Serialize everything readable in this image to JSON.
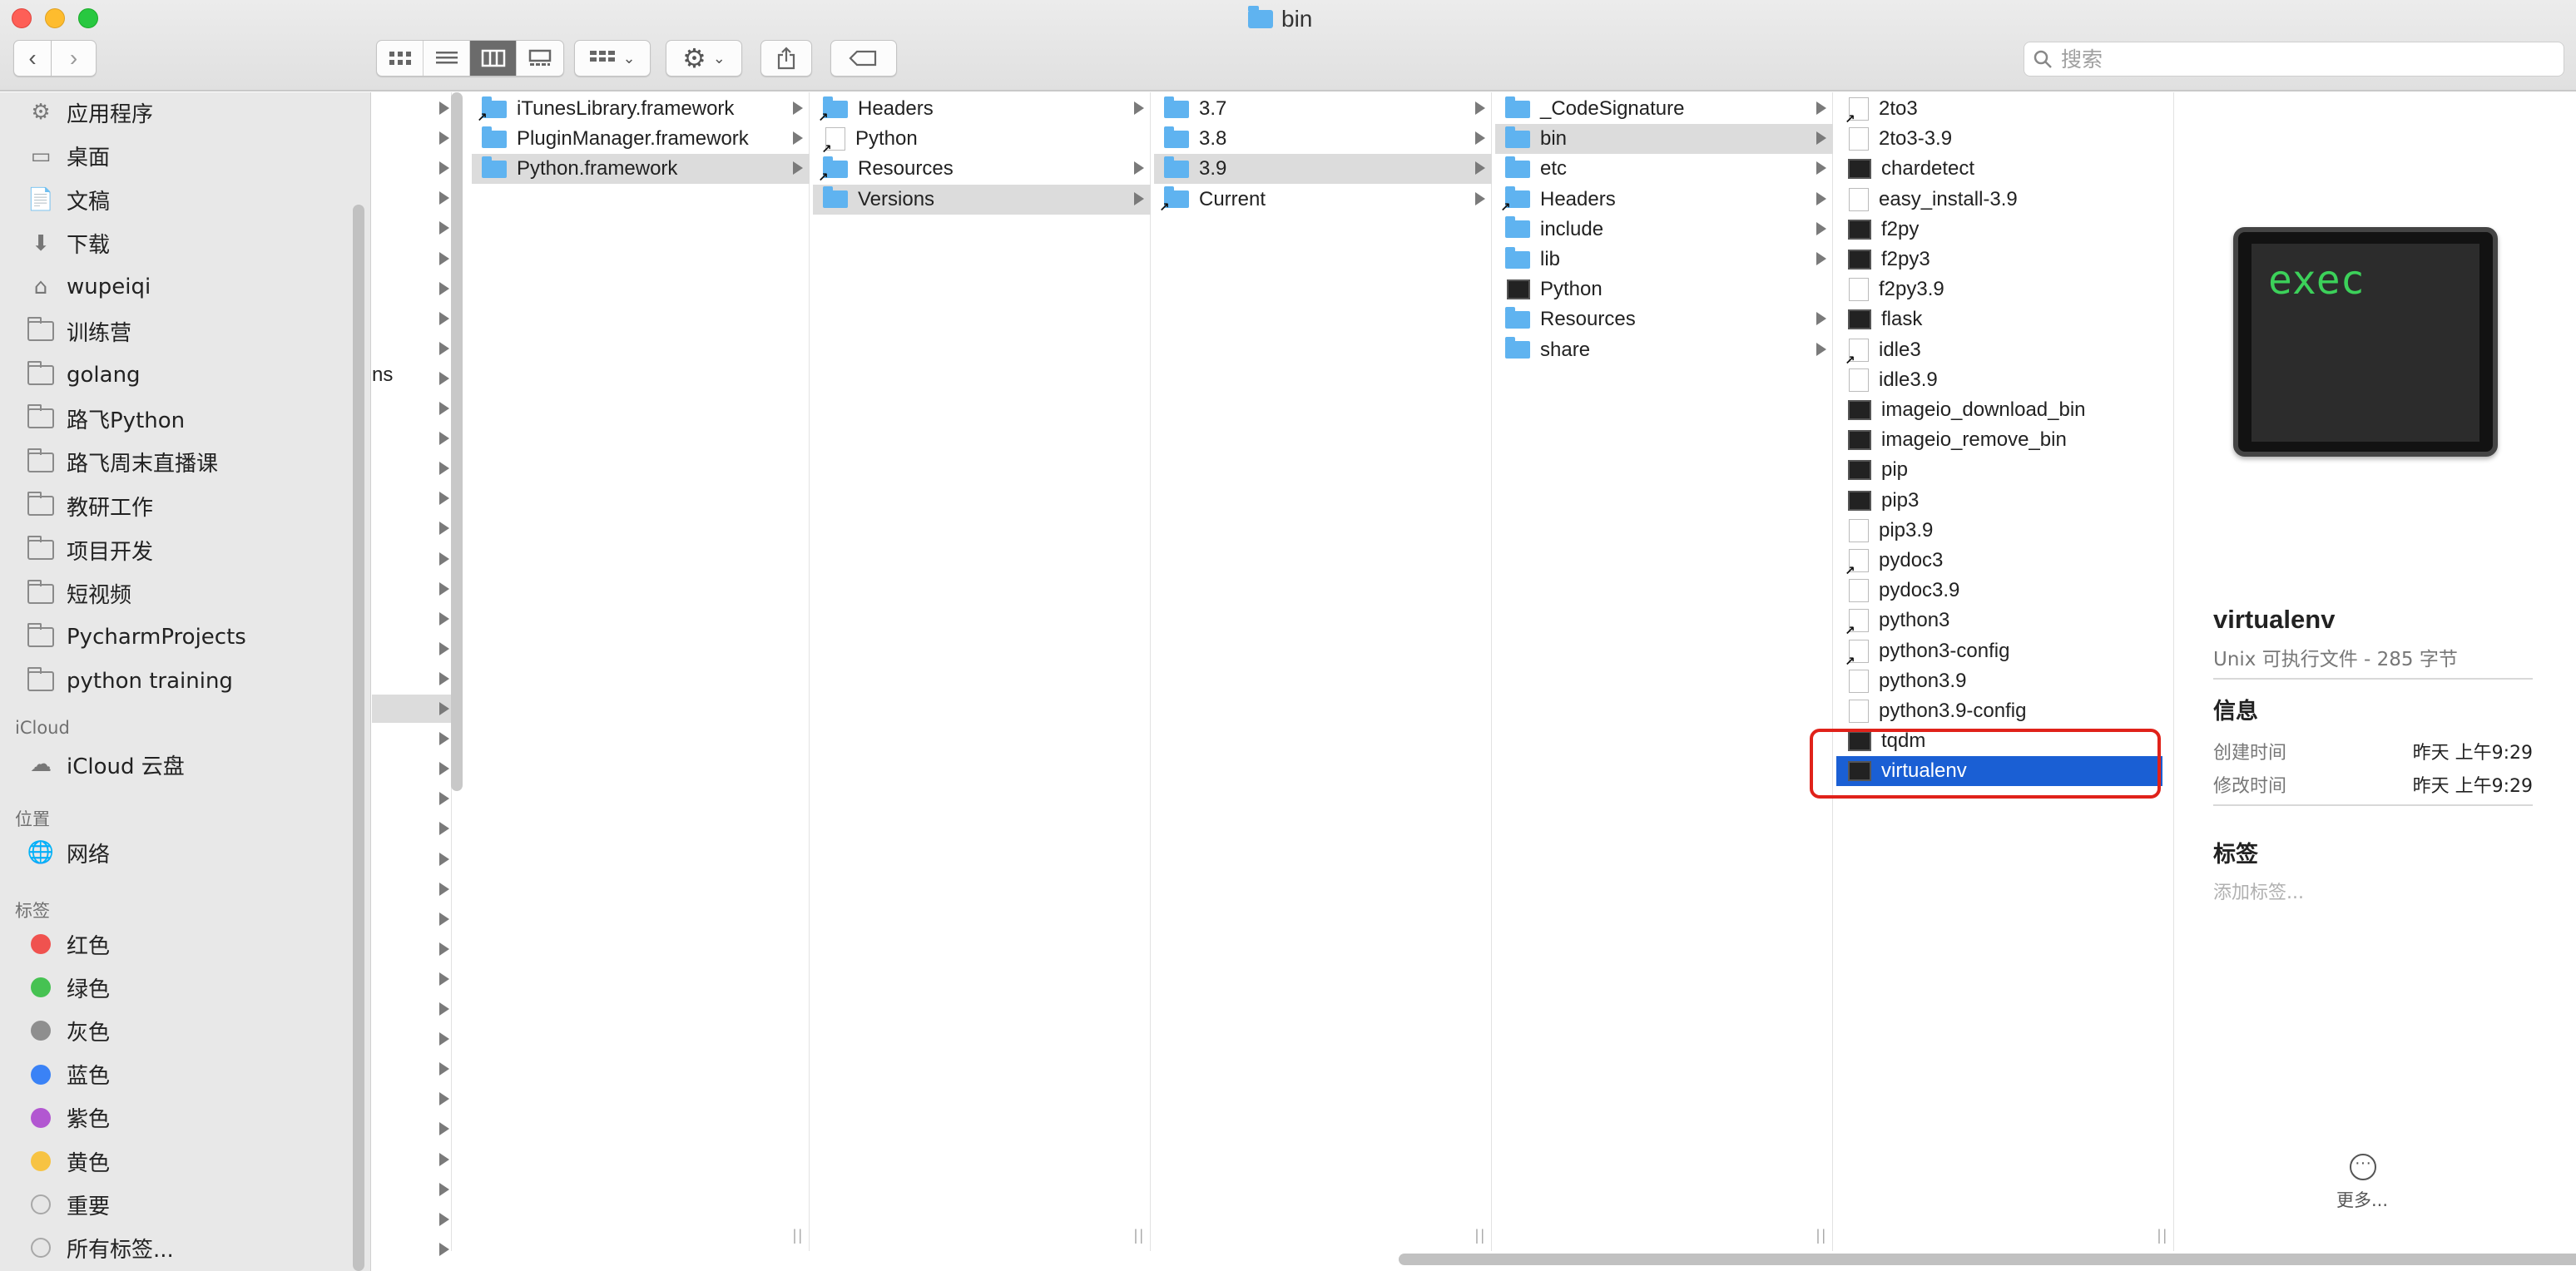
{
  "window": {
    "title": "bin"
  },
  "toolbar": {
    "back": "‹",
    "forward": "›",
    "view_modes": [
      "icon-view-icon",
      "list-view-icon",
      "column-view-icon",
      "gallery-view-icon"
    ],
    "active_view": 2,
    "search_placeholder": "搜索"
  },
  "sidebar": {
    "favorites": [
      {
        "label": "应用程序",
        "icon": "applications-icon"
      },
      {
        "label": "桌面",
        "icon": "desktop-icon"
      },
      {
        "label": "文稿",
        "icon": "documents-icon"
      },
      {
        "label": "下载",
        "icon": "downloads-icon"
      },
      {
        "label": "wupeiqi",
        "icon": "home-icon"
      },
      {
        "label": "训练营",
        "icon": "folder-icon"
      },
      {
        "label": "golang",
        "icon": "folder-icon"
      },
      {
        "label": "路飞Python",
        "icon": "folder-icon"
      },
      {
        "label": "路飞周末直播课",
        "icon": "folder-icon"
      },
      {
        "label": "教研工作",
        "icon": "folder-icon"
      },
      {
        "label": "项目开发",
        "icon": "folder-icon"
      },
      {
        "label": "短视频",
        "icon": "folder-icon"
      },
      {
        "label": "PycharmProjects",
        "icon": "folder-icon"
      },
      {
        "label": "python training",
        "icon": "folder-icon"
      }
    ],
    "icloud_heading": "iCloud",
    "icloud_drive": "iCloud 云盘",
    "locations_heading": "位置",
    "network": "网络",
    "tags_heading": "标签",
    "tags": [
      {
        "label": "红色",
        "color": "#f0524f"
      },
      {
        "label": "绿色",
        "color": "#46c252"
      },
      {
        "label": "灰色",
        "color": "#8e8e8e"
      },
      {
        "label": "蓝色",
        "color": "#3a82f6"
      },
      {
        "label": "紫色",
        "color": "#b257d1"
      },
      {
        "label": "黄色",
        "color": "#f7c343"
      },
      {
        "label": "重要",
        "color": "#e6e6e6"
      },
      {
        "label": "所有标签...",
        "color": "#e6e6e6"
      }
    ]
  },
  "columns": {
    "col0_partial_text": "ns",
    "col1": [
      {
        "name": "iTunesLibrary.framework",
        "type": "folder-alias",
        "chevron": true
      },
      {
        "name": "PluginManager.framework",
        "type": "folder",
        "chevron": true
      },
      {
        "name": "Python.framework",
        "type": "folder",
        "chevron": true,
        "selected": true
      }
    ],
    "col2": [
      {
        "name": "Headers",
        "type": "folder-alias",
        "chevron": true
      },
      {
        "name": "Python",
        "type": "doc-alias",
        "chevron": false
      },
      {
        "name": "Resources",
        "type": "folder-alias",
        "chevron": true
      },
      {
        "name": "Versions",
        "type": "folder",
        "chevron": true,
        "selected": true
      }
    ],
    "col3": [
      {
        "name": "3.7",
        "type": "folder",
        "chevron": true
      },
      {
        "name": "3.8",
        "type": "folder",
        "chevron": true
      },
      {
        "name": "3.9",
        "type": "folder",
        "chevron": true,
        "selected": true
      },
      {
        "name": "Current",
        "type": "folder-alias",
        "chevron": true
      }
    ],
    "col4": [
      {
        "name": "_CodeSignature",
        "type": "folder",
        "chevron": true
      },
      {
        "name": "bin",
        "type": "folder",
        "chevron": true,
        "selected": true
      },
      {
        "name": "etc",
        "type": "folder",
        "chevron": true
      },
      {
        "name": "Headers",
        "type": "folder-alias",
        "chevron": true
      },
      {
        "name": "include",
        "type": "folder",
        "chevron": true
      },
      {
        "name": "lib",
        "type": "folder",
        "chevron": true
      },
      {
        "name": "Python",
        "type": "exec",
        "chevron": false
      },
      {
        "name": "Resources",
        "type": "folder",
        "chevron": true
      },
      {
        "name": "share",
        "type": "folder",
        "chevron": true
      }
    ],
    "col5": [
      {
        "name": "2to3",
        "type": "doc-alias"
      },
      {
        "name": "2to3-3.9",
        "type": "doc"
      },
      {
        "name": "chardetect",
        "type": "exec"
      },
      {
        "name": "easy_install-3.9",
        "type": "doc"
      },
      {
        "name": "f2py",
        "type": "exec"
      },
      {
        "name": "f2py3",
        "type": "exec"
      },
      {
        "name": "f2py3.9",
        "type": "doc"
      },
      {
        "name": "flask",
        "type": "exec"
      },
      {
        "name": "idle3",
        "type": "doc-alias"
      },
      {
        "name": "idle3.9",
        "type": "doc"
      },
      {
        "name": "imageio_download_bin",
        "type": "exec"
      },
      {
        "name": "imageio_remove_bin",
        "type": "exec"
      },
      {
        "name": "pip",
        "type": "exec"
      },
      {
        "name": "pip3",
        "type": "exec"
      },
      {
        "name": "pip3.9",
        "type": "doc"
      },
      {
        "name": "pydoc3",
        "type": "doc-alias"
      },
      {
        "name": "pydoc3.9",
        "type": "doc"
      },
      {
        "name": "python3",
        "type": "doc-alias"
      },
      {
        "name": "python3-config",
        "type": "doc-alias"
      },
      {
        "name": "python3.9",
        "type": "doc"
      },
      {
        "name": "python3.9-config",
        "type": "doc"
      },
      {
        "name": "tqdm",
        "type": "exec"
      },
      {
        "name": "virtualenv",
        "type": "exec",
        "selected": true
      }
    ]
  },
  "preview": {
    "thumb_text": "exec",
    "name": "virtualenv",
    "kind": "Unix 可执行文件 - 285 字节",
    "info_heading": "信息",
    "created_label": "创建时间",
    "created_value": "昨天 上午9:29",
    "modified_label": "修改时间",
    "modified_value": "昨天 上午9:29",
    "tags_heading": "标签",
    "add_tag_placeholder": "添加标签...",
    "more_label": "更多..."
  }
}
